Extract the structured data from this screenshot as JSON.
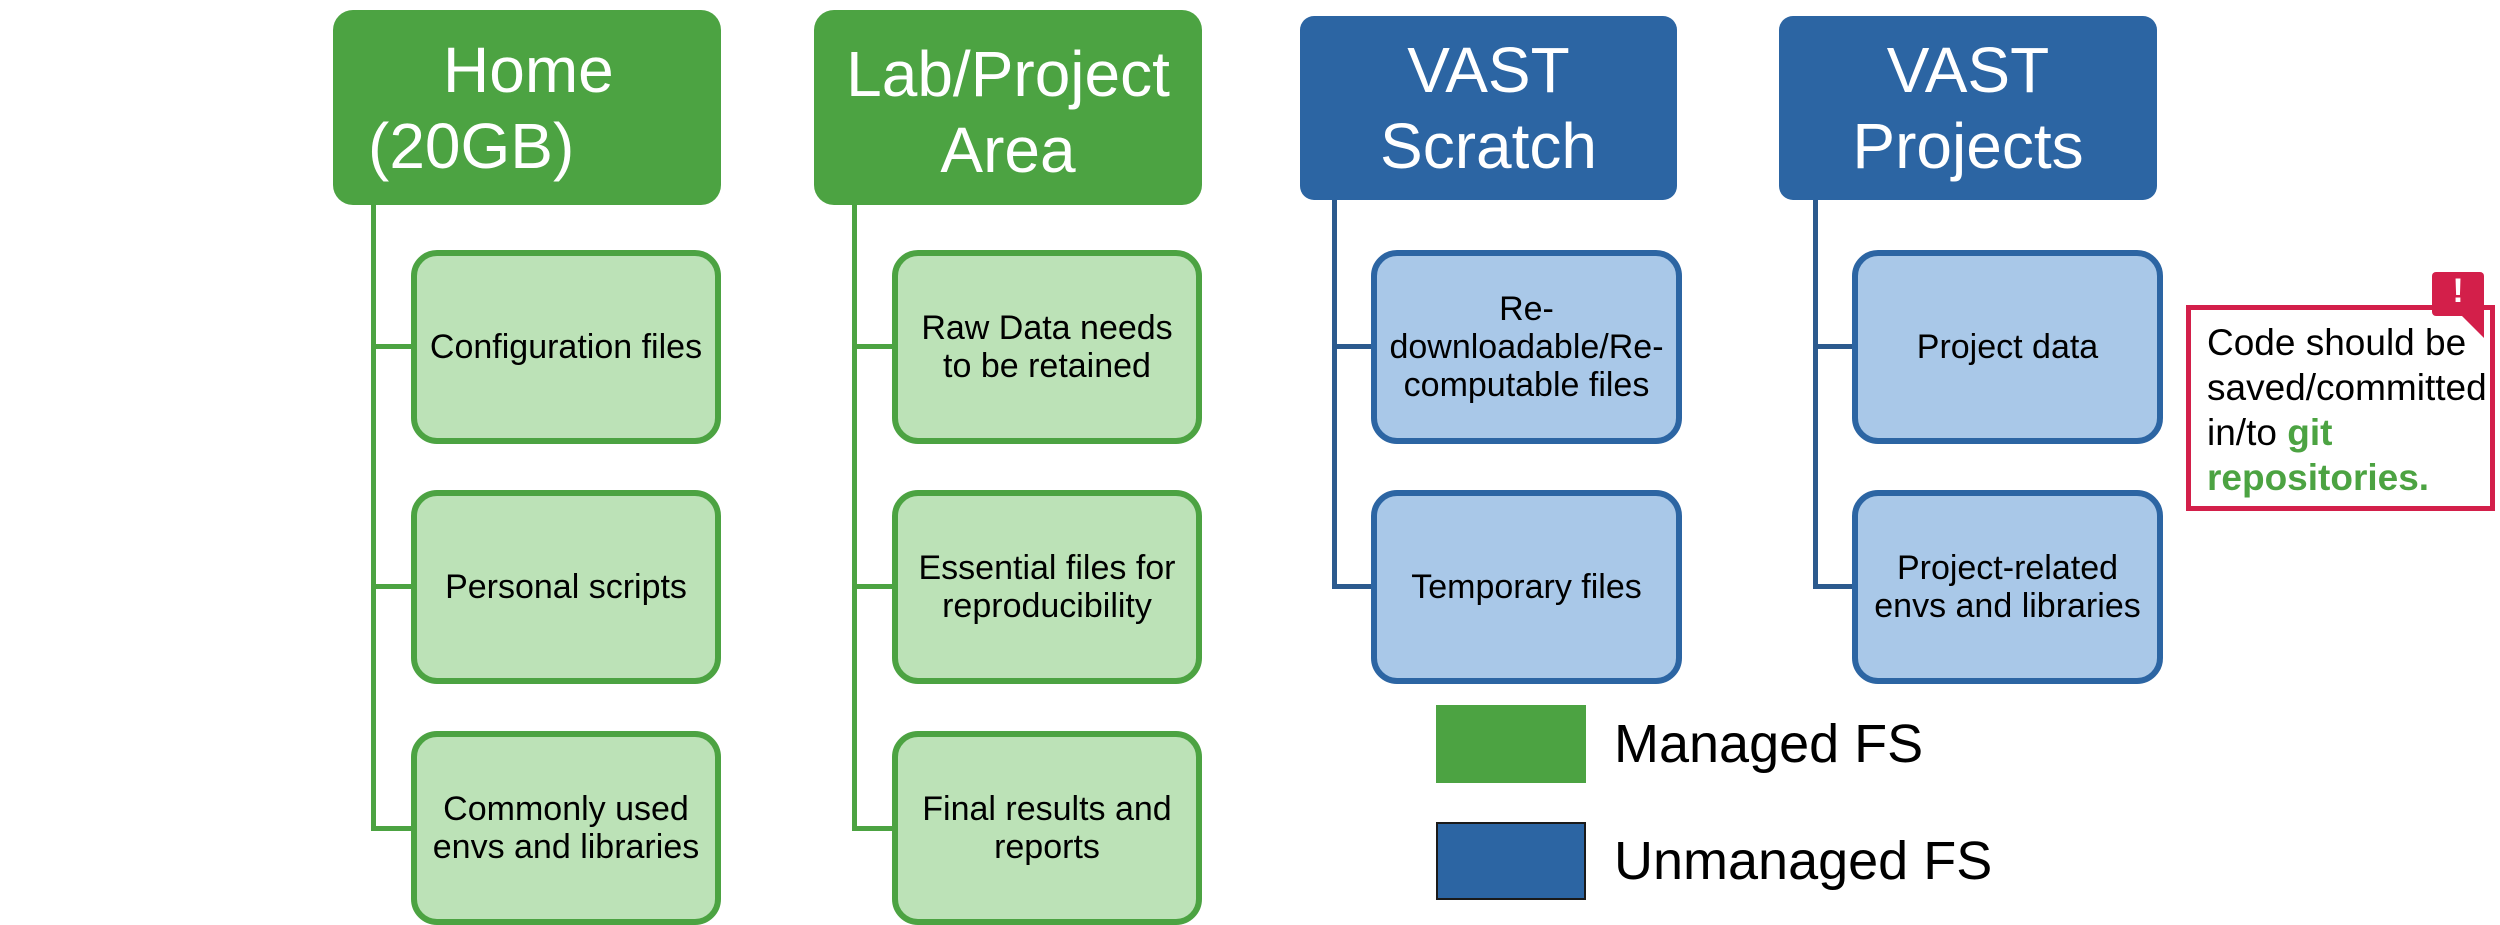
{
  "columns": [
    {
      "id": "home",
      "title_lines": [
        "Home",
        "(20GB)"
      ],
      "category": "managed",
      "items": [
        "Configuration files",
        "Personal scripts",
        "Commonly used envs and libraries"
      ]
    },
    {
      "id": "lab-project-area",
      "title_lines": [
        "Lab/Project",
        "Area"
      ],
      "category": "managed",
      "items": [
        "Raw Data needs to be retained",
        "Essential files for reproducibility",
        "Final results and reports"
      ]
    },
    {
      "id": "vast-scratch",
      "title_lines": [
        "VAST",
        "Scratch"
      ],
      "category": "unmanaged",
      "items": [
        "Re-downloadable/Re-computable files",
        "Temporary files"
      ]
    },
    {
      "id": "vast-projects",
      "title_lines": [
        "VAST",
        "Projects"
      ],
      "category": "unmanaged",
      "items": [
        "Project data",
        "Project-related envs and libraries"
      ]
    }
  ],
  "callout": {
    "badge": "!",
    "text_prefix": "Code should be saved/committed in/to ",
    "text_highlight": "git repositories."
  },
  "legend": [
    {
      "label": "Managed FS",
      "color": "#4ca342"
    },
    {
      "label": "Unmanaged FS",
      "color": "#2c65a3"
    }
  ],
  "colors": {
    "managed_header": "#4ca342",
    "managed_child": "#bce2b7",
    "unmanaged_header": "#2c65a3",
    "unmanaged_child": "#a9c8e8",
    "callout_accent": "#d31f4a"
  }
}
